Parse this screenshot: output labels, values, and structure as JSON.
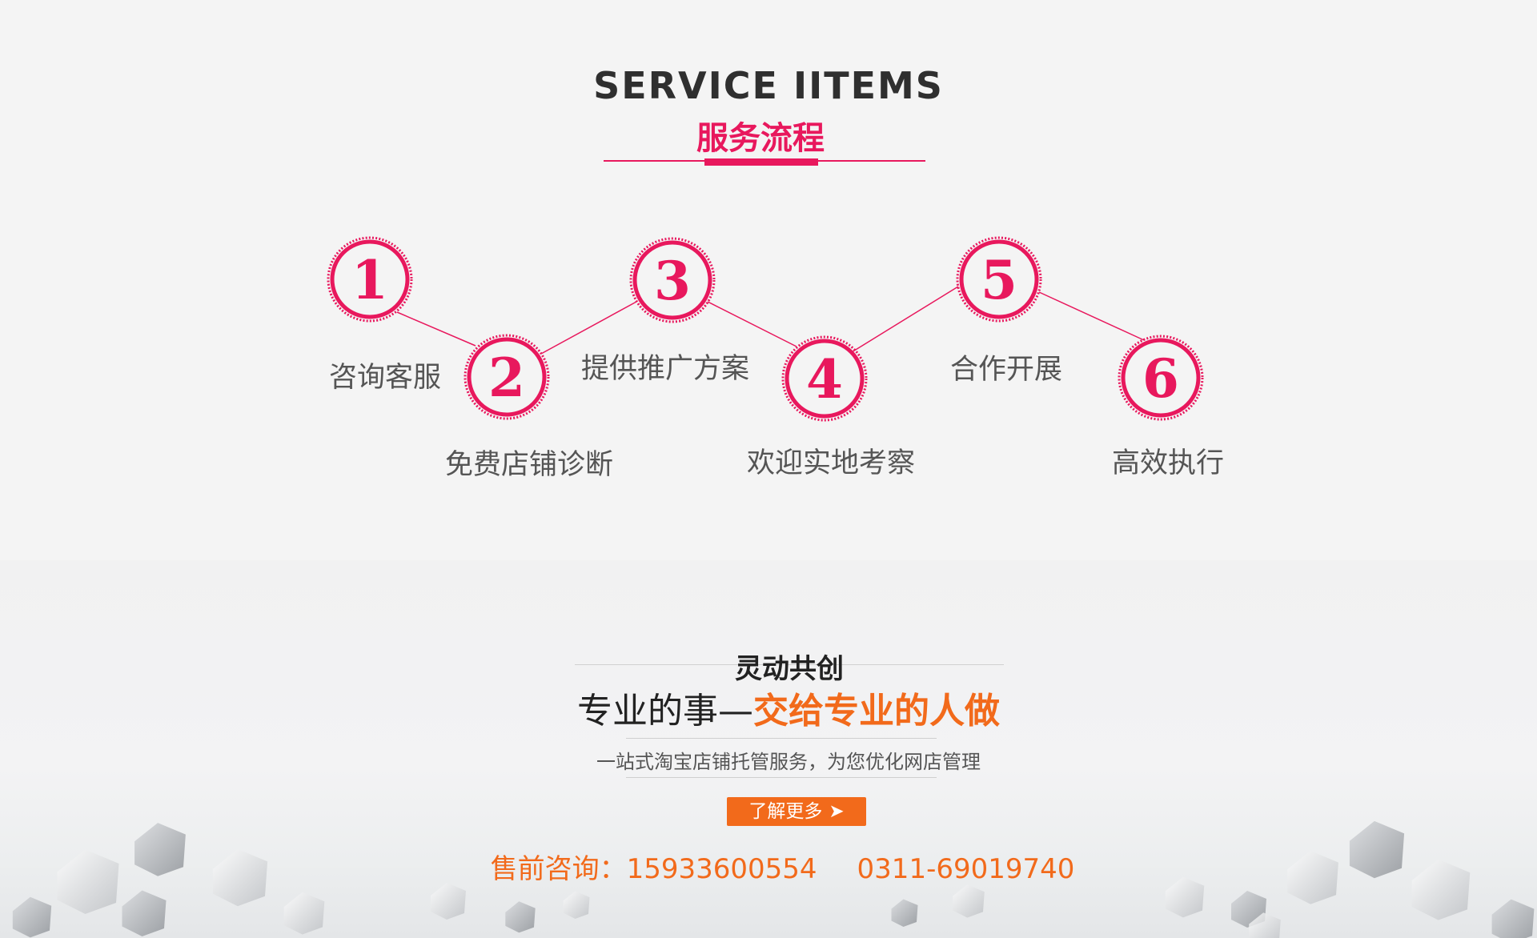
{
  "colors": {
    "accent_pink": "#e8185d",
    "accent_orange": "#f26a1b",
    "text_dark": "#2f2f2f",
    "text_gray": "#555555"
  },
  "service": {
    "title_en": "SERVICE IITEMS",
    "title_cn": "服务流程",
    "steps": [
      {
        "number": "1",
        "label": "咨询客服"
      },
      {
        "number": "2",
        "label": "免费店铺诊断"
      },
      {
        "number": "3",
        "label": "提供推广方案"
      },
      {
        "number": "4",
        "label": "欢迎实地考察"
      },
      {
        "number": "5",
        "label": "合作开展"
      },
      {
        "number": "6",
        "label": "高效执行"
      }
    ]
  },
  "banner": {
    "brand": "灵动共创",
    "slogan_prefix": "专业的事—",
    "slogan_highlight": "交给专业的人做",
    "subtitle": "一站式淘宝店铺托管服务，为您优化网店管理",
    "button_label": "了解更多",
    "button_icon": "arrow-right-icon",
    "phone_label": "售前咨询：",
    "phone_mobile": "15933600554",
    "phone_landline": "0311-69019740"
  }
}
